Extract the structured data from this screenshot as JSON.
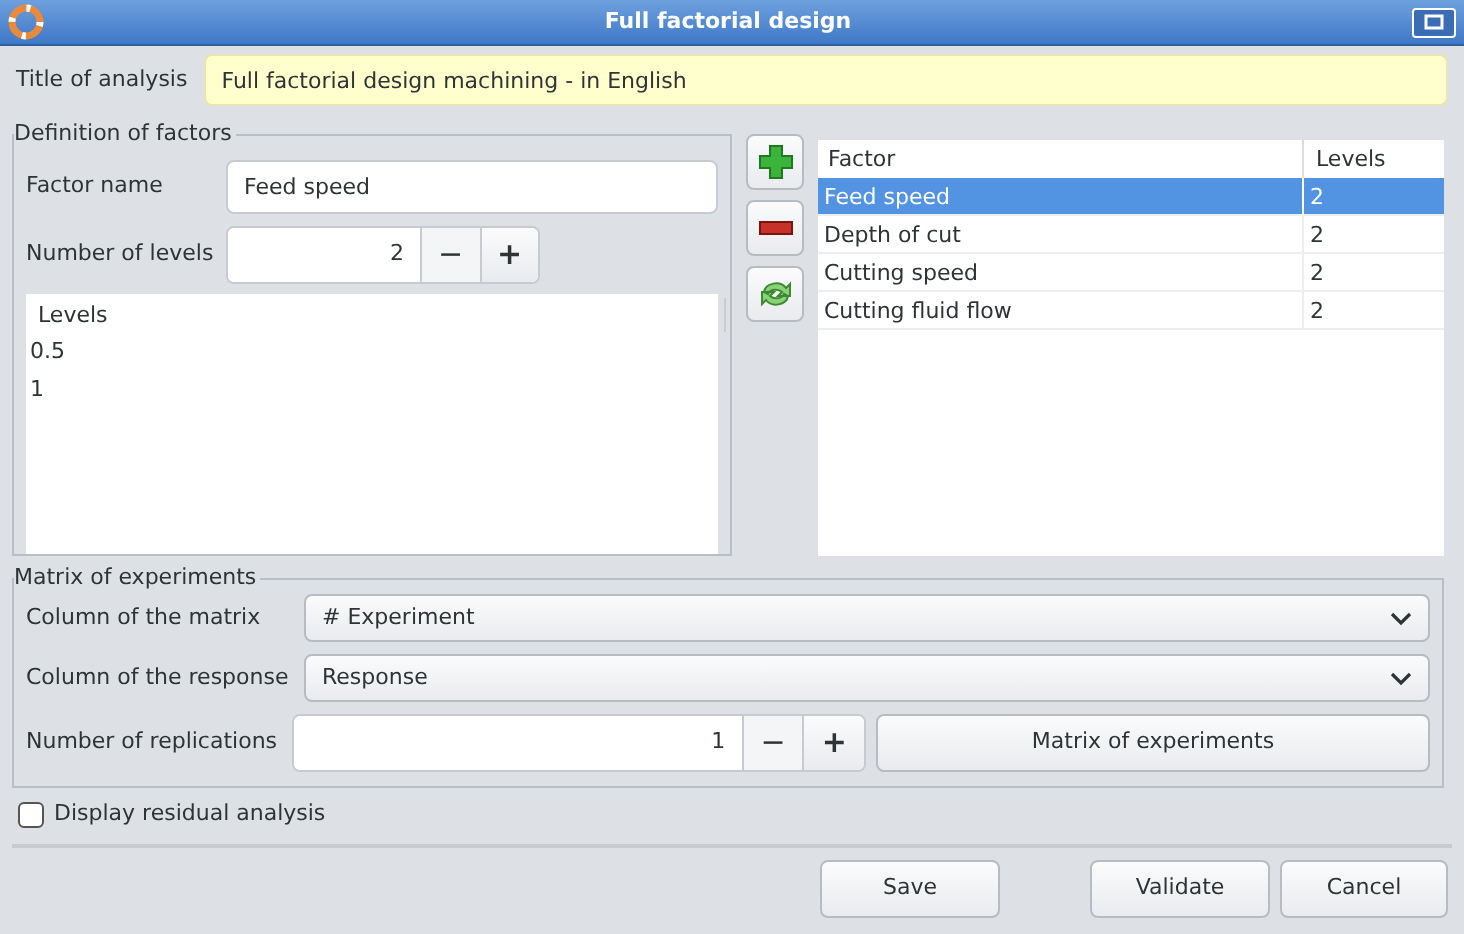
{
  "window": {
    "title": "Full factorial design"
  },
  "title_of_analysis": {
    "label": "Title of analysis",
    "value": "Full factorial design machining - in English"
  },
  "definition": {
    "legend": "Definition of factors",
    "factor_name": {
      "label": "Factor name",
      "value": "Feed speed"
    },
    "levels_count": {
      "label": "Number of levels",
      "value": "2",
      "minus": "−",
      "plus": "+"
    },
    "levels_list": {
      "header": "Levels",
      "items": [
        "0.5",
        "1"
      ]
    }
  },
  "factor_table": {
    "columns": [
      "Factor",
      "Levels"
    ],
    "rows": [
      {
        "factor": "Feed speed",
        "levels": "2",
        "selected": true
      },
      {
        "factor": "Depth of cut",
        "levels": "2",
        "selected": false
      },
      {
        "factor": "Cutting speed",
        "levels": "2",
        "selected": false
      },
      {
        "factor": "Cutting fluid flow",
        "levels": "2",
        "selected": false
      }
    ]
  },
  "matrix": {
    "legend": "Matrix of experiments",
    "column_matrix": {
      "label": "Column of the matrix",
      "value": "# Experiment"
    },
    "column_response": {
      "label": "Column of the response",
      "value": "Response"
    },
    "replications": {
      "label": "Number of replications",
      "value": "1",
      "minus": "−",
      "plus": "+"
    },
    "matrix_button": "Matrix of experiments"
  },
  "residual": {
    "label": "Display residual analysis",
    "checked": false
  },
  "buttons": [
    "Save",
    "Validate",
    "Cancel"
  ]
}
